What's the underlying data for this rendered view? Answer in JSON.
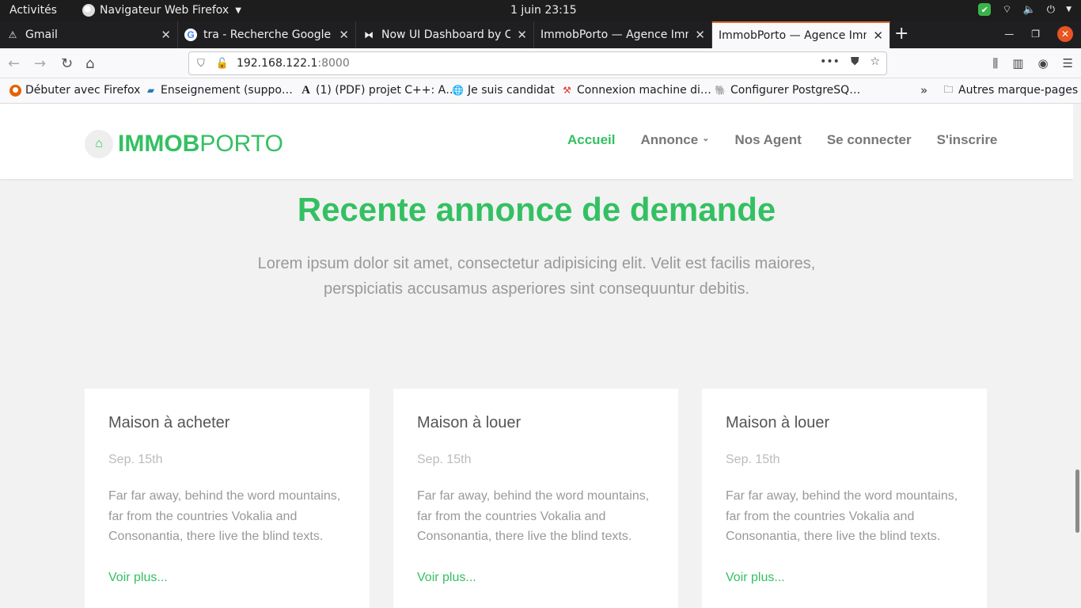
{
  "os": {
    "activities": "Activités",
    "app_name": "Navigateur Web Firefox",
    "clock": "1 juin  23:15"
  },
  "tabs": [
    {
      "label": "Gmail",
      "icon": "warning-icon",
      "active": false
    },
    {
      "label": "tra - Recherche Google",
      "icon": "google-icon",
      "active": false
    },
    {
      "label": "Now UI Dashboard by Cr",
      "icon": "bowtie-icon",
      "active": false
    },
    {
      "label": "ImmobPorto — Agence Imm",
      "icon": "",
      "active": false
    },
    {
      "label": "ImmobPorto — Agence Imm",
      "icon": "",
      "active": true
    }
  ],
  "urlbar": {
    "host": "192.168.122.1",
    "port": ":8000"
  },
  "bookmarks": [
    {
      "label": "Débuter avec Firefox",
      "icon": "firefox-icon"
    },
    {
      "label": "Enseignement (suppo…",
      "icon": "book-icon"
    },
    {
      "label": "(1) (PDF) projet C++: A…",
      "icon": "academia-icon"
    },
    {
      "label": "Je suis candidat",
      "icon": "globe-icon"
    },
    {
      "label": "Connexion machine di…",
      "icon": "pickaxe-icon"
    },
    {
      "label": "Configurer PostgreSQ…",
      "icon": "elephant-icon"
    }
  ],
  "bookmarks_other": "Autres marque-pages",
  "site": {
    "logo_bold": "IMMOB",
    "logo_light": "PORTO",
    "menu": {
      "home": "Accueil",
      "ads": "Annonce",
      "agents": "Nos Agent",
      "login": "Se connecter",
      "signup": "S'inscrire"
    },
    "heading": "Recente annonce de demande",
    "lead": "Lorem ipsum dolor sit amet, consectetur adipisicing elit. Velit est facilis maiores, perspiciatis accusamus asperiores sint consequuntur debitis.",
    "cards": [
      {
        "title": "Maison à acheter",
        "date": "Sep. 15th",
        "text": "Far far away, behind the word mountains, far from the countries Vokalia and Consonantia, there live the blind texts.",
        "link": "Voir plus..."
      },
      {
        "title": "Maison à louer",
        "date": "Sep. 15th",
        "text": "Far far away, behind the word mountains, far from the countries Vokalia and Consonantia, there live the blind texts.",
        "link": "Voir plus..."
      },
      {
        "title": "Maison à louer",
        "date": "Sep. 15th",
        "text": "Far far away, behind the word mountains, far from the countries Vokalia and Consonantia, there live the blind texts.",
        "link": "Voir plus..."
      }
    ]
  },
  "colors": {
    "accent": "#34c062",
    "tab_highlight": "#e0662a"
  }
}
